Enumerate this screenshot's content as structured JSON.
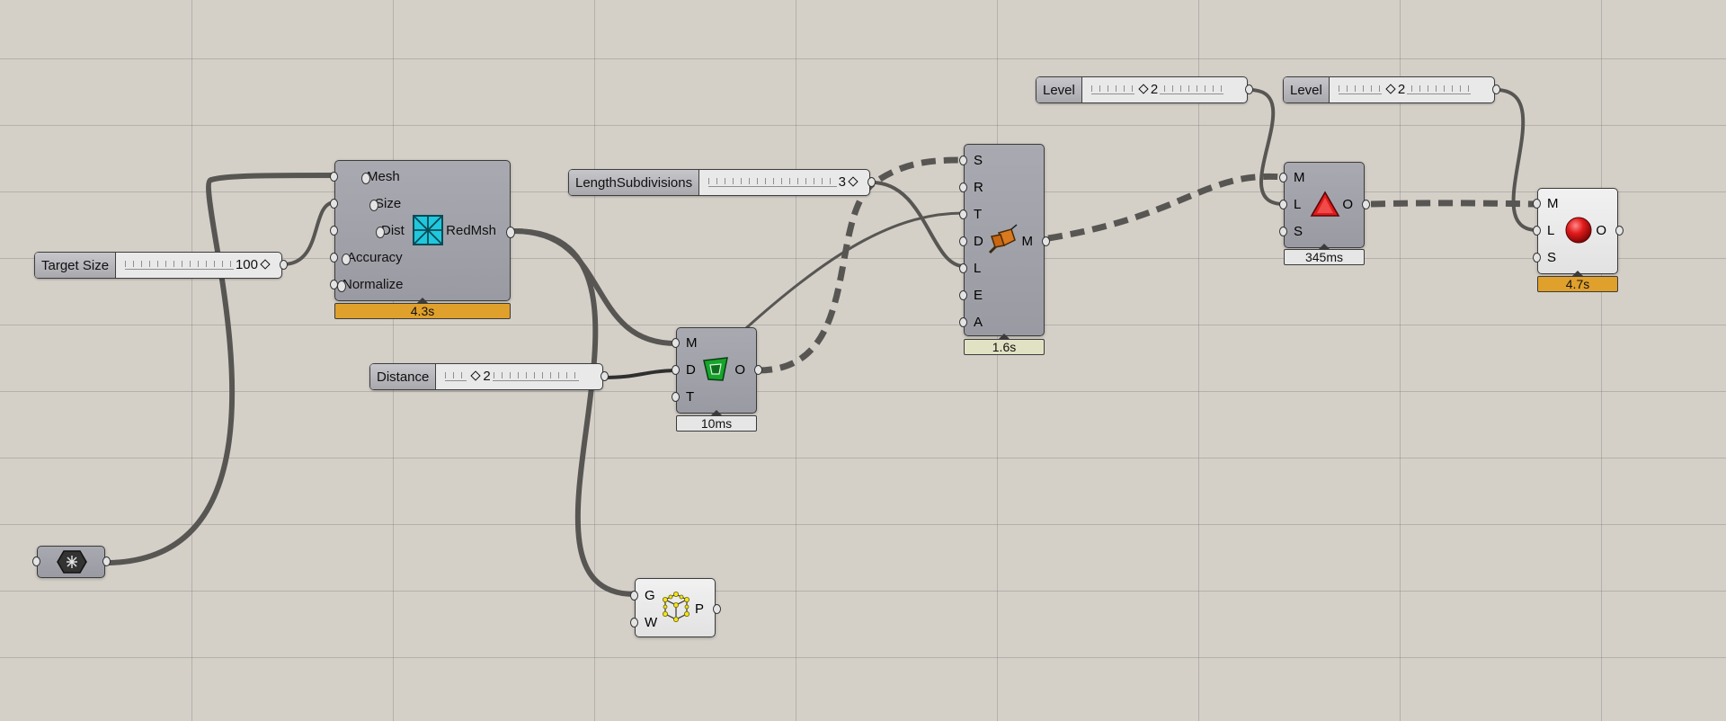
{
  "sliders": {
    "target_size": {
      "label": "Target Size",
      "value": "100"
    },
    "length_subdivisions": {
      "label": "LengthSubdivisions",
      "value": "3"
    },
    "distance": {
      "label": "Distance",
      "value": "2"
    },
    "level_1": {
      "label": "Level",
      "value": "2"
    },
    "level_2": {
      "label": "Level",
      "value": "2"
    }
  },
  "reduce_mesh": {
    "inputs": [
      "Mesh",
      "Size",
      "Dist",
      "Accuracy",
      "Normalize"
    ],
    "output": "RedMsh",
    "timer": "4.3s",
    "icon": "reduce-mesh-icon"
  },
  "offset_mesh": {
    "inputs": [
      "M",
      "D",
      "T"
    ],
    "output": "O",
    "timer": "10ms",
    "icon": "mesh-offset-icon"
  },
  "mesh_builder": {
    "inputs": [
      "S",
      "R",
      "T",
      "D",
      "L",
      "E",
      "A"
    ],
    "output": "M",
    "timer": "1.6s",
    "icon": "mesh-builder-icon"
  },
  "subdivide_1": {
    "inputs": [
      "M",
      "L",
      "S"
    ],
    "output": "O",
    "timer": "345ms",
    "icon": "red-triangle-icon"
  },
  "subdivide_2": {
    "inputs": [
      "M",
      "L",
      "S"
    ],
    "output": "O",
    "timer": "4.7s",
    "icon": "red-sphere-icon"
  },
  "preview": {
    "inputs": [
      "G",
      "W"
    ],
    "output": "P",
    "icon": "wireframe-preview-icon"
  },
  "mesh_param": {
    "icon": "mesh-param-icon"
  },
  "colors": {
    "canvas": "#d4d0c8",
    "component": "#a3a3ab",
    "timer_slow": "#e0a02c",
    "timer_mid": "#e1e2c4",
    "wire": "#555555"
  }
}
